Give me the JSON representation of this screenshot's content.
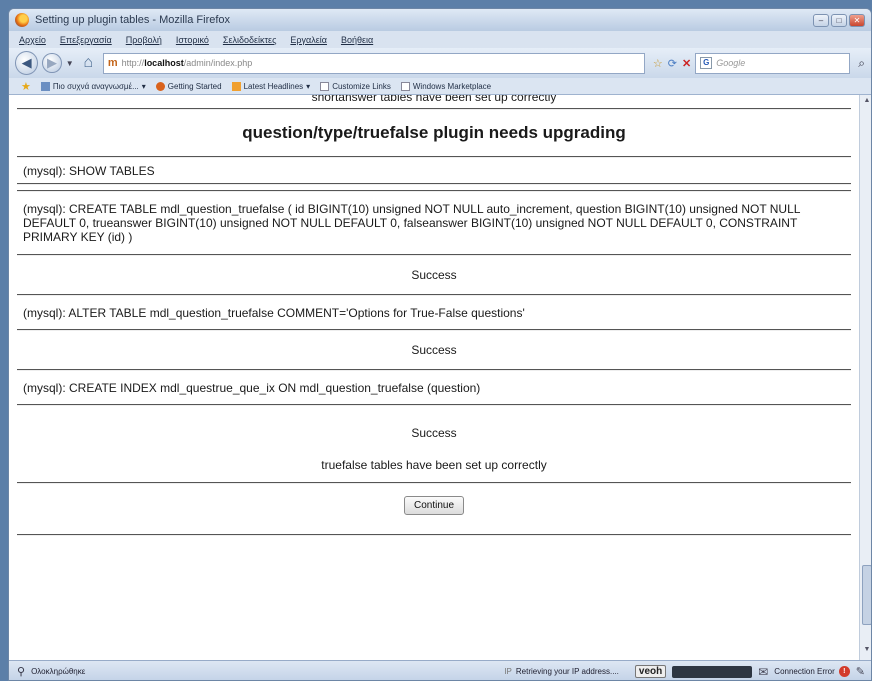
{
  "window": {
    "title": "Setting up plugin tables - Mozilla Firefox"
  },
  "menu": [
    "Αρχείο",
    "Επεξεργασία",
    "Προβολή",
    "Ιστορικό",
    "Σελιδοδείκτες",
    "Εργαλεία",
    "Βοήθεια"
  ],
  "nav": {
    "url_prefix": "http://",
    "url_host": "localhost",
    "url_path": "/admin/index.php",
    "search_placeholder": "Google"
  },
  "bookmarks": [
    "Πιο συχνά αναγνωσμέ...",
    "Getting Started",
    "Latest Headlines",
    "Customize Links",
    "Windows Marketplace"
  ],
  "page": {
    "top_cut_text": "shortanswer tables have been set up correctly",
    "heading": "question/type/truefalse plugin needs upgrading",
    "sql1": "(mysql): SHOW TABLES",
    "sql2": "(mysql): CREATE TABLE mdl_question_truefalse ( id BIGINT(10) unsigned NOT NULL auto_increment, question BIGINT(10) unsigned NOT NULL DEFAULT 0, trueanswer BIGINT(10) unsigned NOT NULL DEFAULT 0, falseanswer BIGINT(10) unsigned NOT NULL DEFAULT 0, CONSTRAINT PRIMARY KEY (id) )",
    "success1": "Success",
    "sql3": "(mysql): ALTER TABLE mdl_question_truefalse COMMENT='Options for True-False questions'",
    "success2": "Success",
    "sql4": "(mysql): CREATE INDEX mdl_questrue_que_ix ON mdl_question_truefalse (question)",
    "success3": "Success",
    "done_text": "truefalse tables have been set up correctly",
    "continue_label": "Continue"
  },
  "status": {
    "left": "Ολοκληρώθηκε",
    "ip": "Retrieving your IP address....",
    "veoh": "veoh",
    "connection": "Connection Error"
  }
}
